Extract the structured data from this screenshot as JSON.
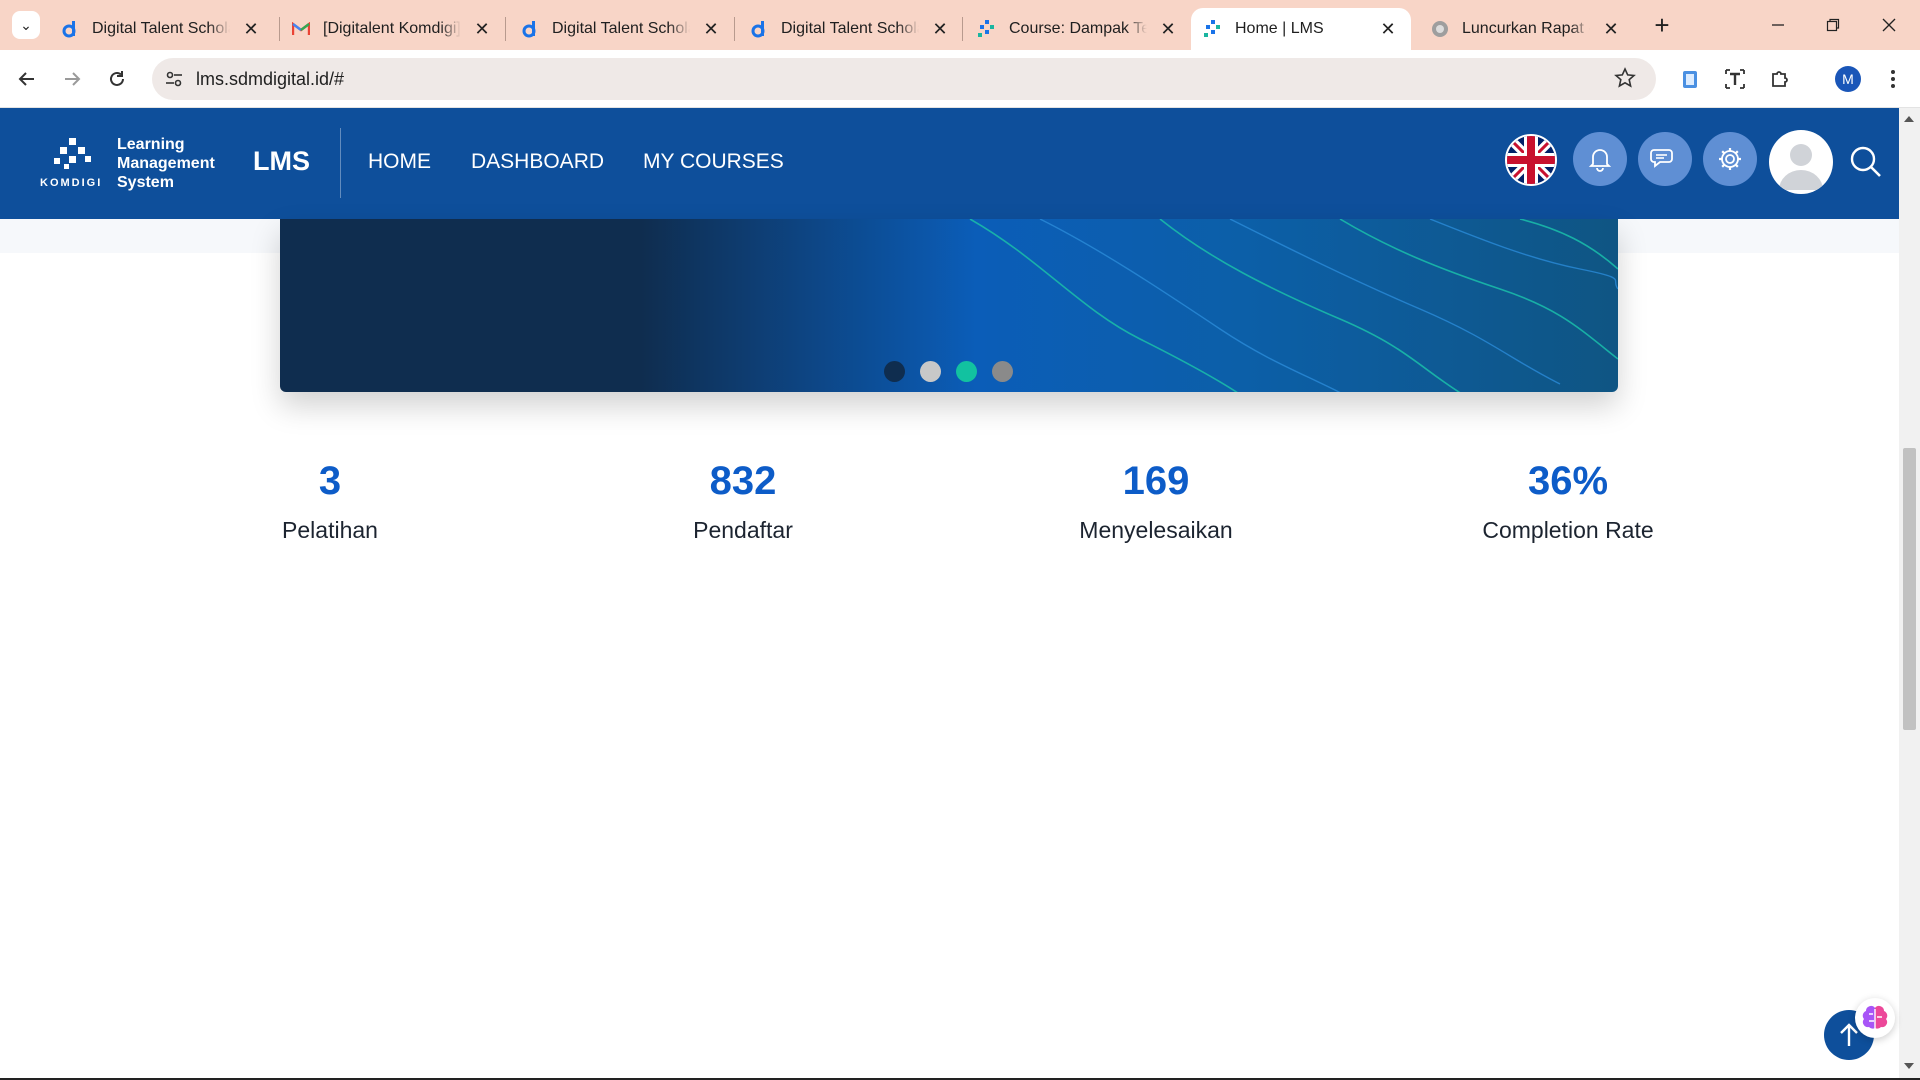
{
  "browser": {
    "tabs": [
      {
        "title": "Digital Talent Scholarship",
        "icon": "digitalent-icon"
      },
      {
        "title": "[Digitalent Komdigi] ",
        "icon": "gmail-icon"
      },
      {
        "title": "Digital Talent Scholarship",
        "icon": "digitalent-icon"
      },
      {
        "title": "Digital Talent Scholarship",
        "icon": "digitalent-icon"
      },
      {
        "title": "Course: Dampak Teknologi",
        "icon": "komdigi-icon"
      },
      {
        "title": "Home | LMS",
        "icon": "komdigi-icon",
        "active": true
      },
      {
        "title": "Luncurkan Rapat - Zoom",
        "icon": "globe-icon"
      }
    ],
    "url": "lms.sdmdigital.id/#",
    "profile_initial": "M",
    "tabstrip_color": "#f8d5c7"
  },
  "header": {
    "logo_lines": [
      "Learning",
      "Management",
      "System"
    ],
    "logo_brand": "KOMDIGI",
    "app_title": "LMS",
    "nav": [
      "HOME",
      "DASHBOARD",
      "MY COURSES"
    ],
    "background": "#0e4f9b"
  },
  "banner": {
    "dots": [
      {
        "color": "#0f2d4f"
      },
      {
        "color": "#c8c8c8"
      },
      {
        "color": "#12c2a0",
        "active": true
      },
      {
        "color": "#8a8a8a"
      }
    ]
  },
  "stats": [
    {
      "value": "3",
      "label": "Pelatihan"
    },
    {
      "value": "832",
      "label": "Pendaftar"
    },
    {
      "value": "169",
      "label": "Menyelesaikan"
    },
    {
      "value": "36%",
      "label": "Completion Rate"
    }
  ],
  "colors": {
    "accent": "#0d5cc8",
    "header": "#0e4f9b"
  }
}
